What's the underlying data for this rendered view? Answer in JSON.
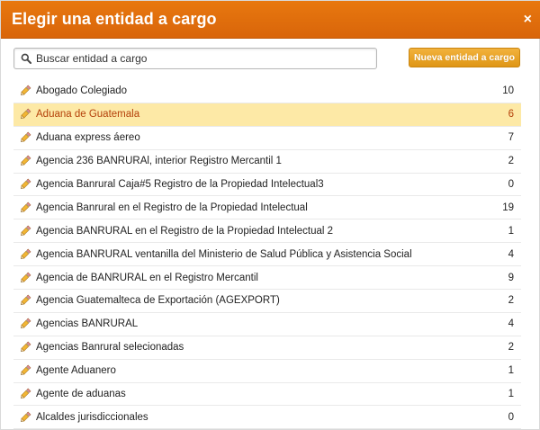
{
  "dialog": {
    "title": "Elegir una entidad a cargo",
    "close_glyph": "×"
  },
  "search": {
    "placeholder": "Buscar entidad a cargo",
    "value": "",
    "icon": "search-icon"
  },
  "new_button_label": "Nueva entidad a cargo",
  "colors": {
    "titlebar": "#e1700c",
    "button": "#e8a52a",
    "selected_row": "#fde9a6",
    "selected_text": "#b4400a"
  },
  "items": [
    {
      "label": "Abogado Colegiado",
      "count": "10",
      "selected": false
    },
    {
      "label": "Aduana de Guatemala",
      "count": "6",
      "selected": true
    },
    {
      "label": "Aduana express áereo",
      "count": "7",
      "selected": false
    },
    {
      "label": "Agencia 236 BANRURAl, interior Registro Mercantil 1",
      "count": "2",
      "selected": false
    },
    {
      "label": "Agencia Banrural Caja#5 Registro de la Propiedad Intelectual3",
      "count": "0",
      "selected": false
    },
    {
      "label": "Agencia Banrural en el Registro de la Propiedad Intelectual",
      "count": "19",
      "selected": false
    },
    {
      "label": "Agencia BANRURAL en el Registro de la Propiedad Intelectual 2",
      "count": "1",
      "selected": false
    },
    {
      "label": "Agencia BANRURAL ventanilla del Ministerio de Salud Pública y Asistencia Social",
      "count": "4",
      "selected": false
    },
    {
      "label": "Agencia de BANRURAL en el Registro Mercantil",
      "count": "9",
      "selected": false
    },
    {
      "label": "Agencia Guatemalteca de Exportación (AGEXPORT)",
      "count": "2",
      "selected": false
    },
    {
      "label": "Agencias BANRURAL",
      "count": "4",
      "selected": false
    },
    {
      "label": "Agencias Banrural selecionadas",
      "count": "2",
      "selected": false
    },
    {
      "label": "Agente Aduanero",
      "count": "1",
      "selected": false
    },
    {
      "label": "Agente de aduanas",
      "count": "1",
      "selected": false
    },
    {
      "label": "Alcaldes jurisdiccionales",
      "count": "0",
      "selected": false
    }
  ]
}
